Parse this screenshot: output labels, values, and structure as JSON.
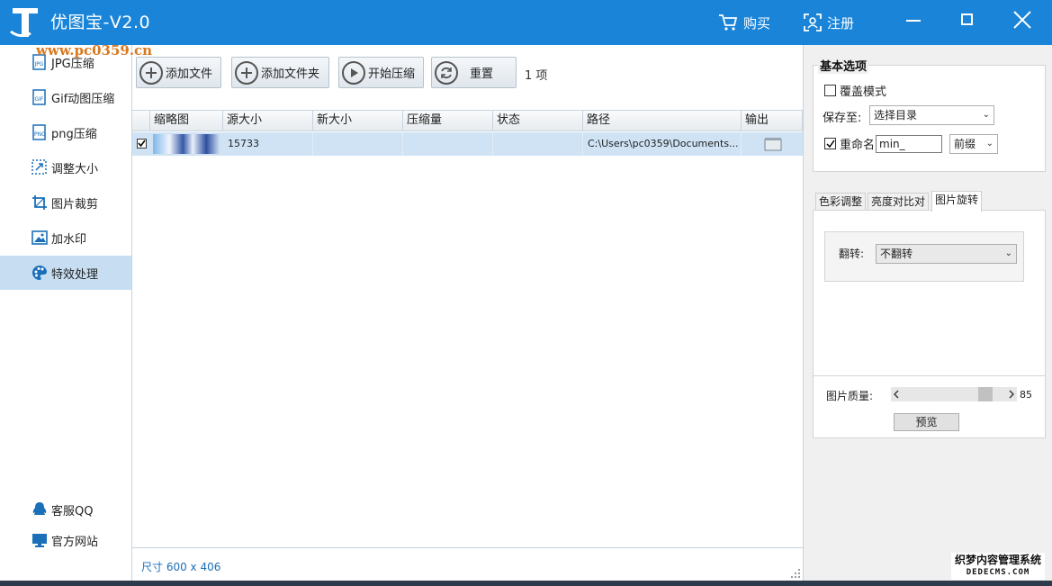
{
  "window": {
    "title": "优图宝-V2.0",
    "watermark": "www.pc0359.cn"
  },
  "titlebar": {
    "buy_label": "购买",
    "register_label": "注册"
  },
  "sidebar": {
    "items": [
      {
        "label": "JPG压缩",
        "icon": "jpg-icon"
      },
      {
        "label": "Gif动图压缩",
        "icon": "gif-icon"
      },
      {
        "label": "png压缩",
        "icon": "png-icon"
      },
      {
        "label": "调整大小",
        "icon": "resize-icon"
      },
      {
        "label": "图片裁剪",
        "icon": "crop-icon"
      },
      {
        "label": "加水印",
        "icon": "image-icon"
      },
      {
        "label": "特效处理",
        "icon": "palette-icon",
        "active": true
      }
    ],
    "bottom": [
      {
        "label": "客服QQ",
        "icon": "qq-icon"
      },
      {
        "label": "官方网站",
        "icon": "monitor-icon"
      }
    ]
  },
  "toolbar": {
    "add_file": "添加文件",
    "add_folder": "添加文件夹",
    "start_compress": "开始压缩",
    "reset": "重置",
    "count": "1 项"
  },
  "table": {
    "columns": [
      "缩略图",
      "源大小",
      "新大小",
      "压缩量",
      "状态",
      "路径",
      "输出"
    ],
    "rows": [
      {
        "checked": true,
        "src_size": "15733",
        "new_size": "",
        "ratio": "",
        "status": "",
        "path": "C:\\Users\\pc0359\\Documents..."
      }
    ]
  },
  "status": {
    "size_text": "尺寸 600 x 406"
  },
  "basic": {
    "title": "基本选项",
    "overwrite_label": "覆盖模式",
    "overwrite_checked": false,
    "save_to_label": "保存至:",
    "save_to_value": "选择目录",
    "rename_label": "重命名",
    "rename_checked": true,
    "rename_value": "min_",
    "rename_mode": "前缀"
  },
  "tabs": {
    "items": [
      "色彩调整",
      "亮度对比对",
      "图片旋转"
    ],
    "active": 2
  },
  "rotate": {
    "flip_label": "翻转:",
    "flip_value": "不翻转"
  },
  "quality": {
    "label": "图片质量:",
    "value": 85,
    "value_text": "85",
    "min": 0,
    "max": 100,
    "preview_label": "预览"
  },
  "corner_watermark": {
    "line1": "织梦内容管理系统",
    "line2": "DEDECMS.COM"
  },
  "colors": {
    "titlebar": "#1a84d8",
    "active_item": "#c7def2",
    "selected_row": "#cfe3f5"
  }
}
